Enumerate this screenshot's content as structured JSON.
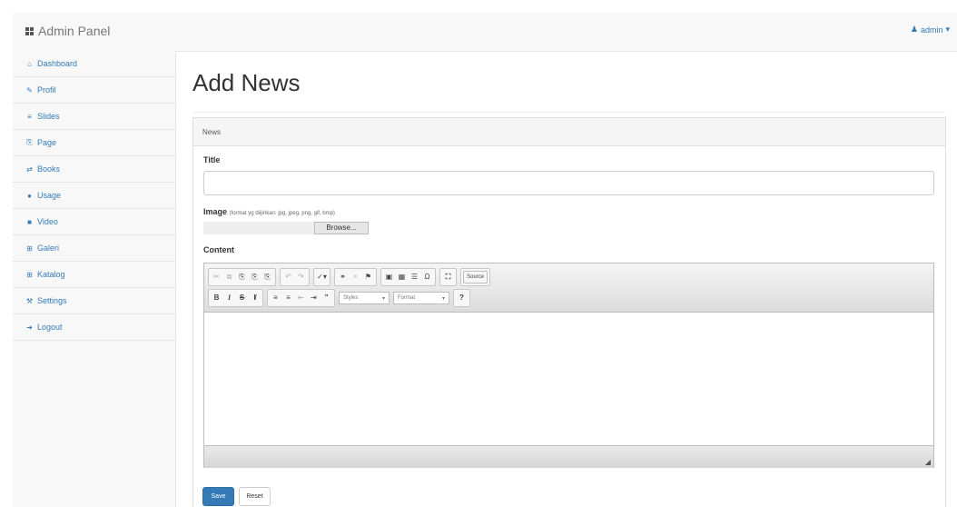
{
  "brand": {
    "title": "Admin Panel"
  },
  "user_menu": {
    "label": "admin"
  },
  "sidebar": {
    "items": [
      {
        "label": "Dashboard",
        "icon": "dashboard-icon",
        "glyph": "⌂"
      },
      {
        "label": "Profil",
        "icon": "edit-icon",
        "glyph": "✎"
      },
      {
        "label": "Slides",
        "icon": "slides-icon",
        "glyph": "≡"
      },
      {
        "label": "Page",
        "icon": "page-icon",
        "glyph": "⎘"
      },
      {
        "label": "Books",
        "icon": "books-icon",
        "glyph": "⇄"
      },
      {
        "label": "Usage",
        "icon": "comment-icon",
        "glyph": "●"
      },
      {
        "label": "Video",
        "icon": "video-icon",
        "glyph": "■"
      },
      {
        "label": "Galeri",
        "icon": "gallery-icon",
        "glyph": "⊞"
      },
      {
        "label": "Katalog",
        "icon": "catalog-icon",
        "glyph": "⊞"
      },
      {
        "label": "Settings",
        "icon": "wrench-icon",
        "glyph": "⚒"
      },
      {
        "label": "Logout",
        "icon": "logout-icon",
        "glyph": "➜"
      }
    ]
  },
  "main": {
    "title": "Add News",
    "panel_heading": "News",
    "title_label": "Title",
    "title_value": "",
    "image_label": "Image",
    "image_hint": "(format yg diijinkan: jpg, jpeg, png, gif, bmp)",
    "browse_label": "Browse...",
    "content_label": "Content",
    "toolbar": {
      "source_label": "Source",
      "styles_label": "Styles",
      "format_label": "Format",
      "help_label": "?"
    },
    "save_label": "Save",
    "reset_label": "Reset"
  },
  "colors": {
    "accent": "#337ab7",
    "sidebar_bg": "#f8f8f8"
  }
}
